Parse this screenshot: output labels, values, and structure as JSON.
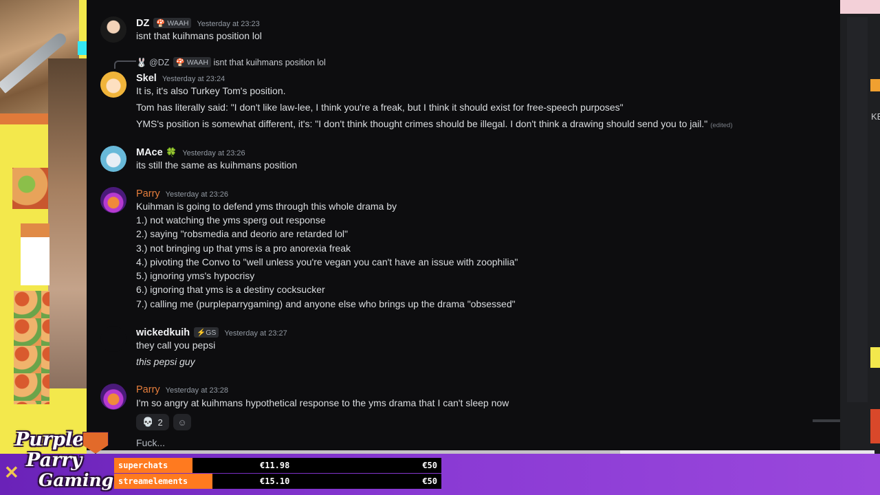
{
  "messages": [
    {
      "user": "DZ",
      "badge": "🍄 WAAH",
      "time": "Yesterday at 23:23",
      "lines": [
        "isnt that kuihmans position lol"
      ]
    },
    {
      "user": "Skel",
      "time": "Yesterday at 23:24",
      "reply": {
        "user": "@DZ",
        "badge": "🍄 WAAH",
        "text": "isnt that kuihmans position lol"
      },
      "lines": [
        "It is, it's also Turkey Tom's position.",
        "Tom has literally said: \"I don't like law-lee, I think you're a freak, but I think it should exist for free-speech purposes\"",
        "YMS's position is somewhat different, it's: \"I don't think thought crimes should be illegal. I don't think a drawing should send you to jail.\""
      ],
      "edited": "(edited)"
    },
    {
      "user": "MAce",
      "badge_icon": "🍀",
      "time": "Yesterday at 23:26",
      "lines": [
        "its still the same as kuihmans position"
      ]
    },
    {
      "user": "Parry",
      "time": "Yesterday at 23:26",
      "lines": [
        "Kuihman is going to defend yms through this whole drama by",
        "1.) not watching the yms sperg out response",
        "2.) saying \"robsmedia and deorio are retarded lol\"",
        "3.) not bringing up that yms is a pro anorexia freak",
        "4.) pivoting the Convo to \"well unless you're vegan you can't have an issue with zoophilia\"",
        "5.) ignoring yms's hypocrisy",
        "6.) ignoring that yms is a destiny cocksucker",
        "7.) calling me (purpleparrygaming) and anyone else who brings up the drama \"obsessed\""
      ]
    },
    {
      "user": "wickedkuih",
      "badge": "⚡GS",
      "time": "Yesterday at 23:27",
      "lines": [
        "they call you pepsi",
        "this pepsi guy"
      ]
    },
    {
      "user": "Parry",
      "time": "Yesterday at 23:28",
      "lines": [
        "I'm so angry at kuihmans hypothetical response to the yms drama that I can't sleep now"
      ],
      "reactions": [
        {
          "icon": "💀",
          "count": "2"
        },
        {
          "icon": "☺"
        }
      ]
    },
    {
      "lines": [
        "Fuck..."
      ]
    }
  ],
  "side": {
    "right_text": "KE"
  },
  "logo": {
    "l1": "Purple",
    "l2": "Parry",
    "l3": "Gaming"
  },
  "goals": [
    {
      "label": "superchats",
      "current": "€11.98",
      "goal": "€50",
      "progress": 0.24
    },
    {
      "label": "streamelements",
      "current": "€15.10",
      "goal": "€50",
      "progress": 0.3
    }
  ],
  "colors": {
    "accent": "#ff7a1f",
    "chat_bg": "#0d0d0f",
    "bottom": "#8a3ad4"
  }
}
